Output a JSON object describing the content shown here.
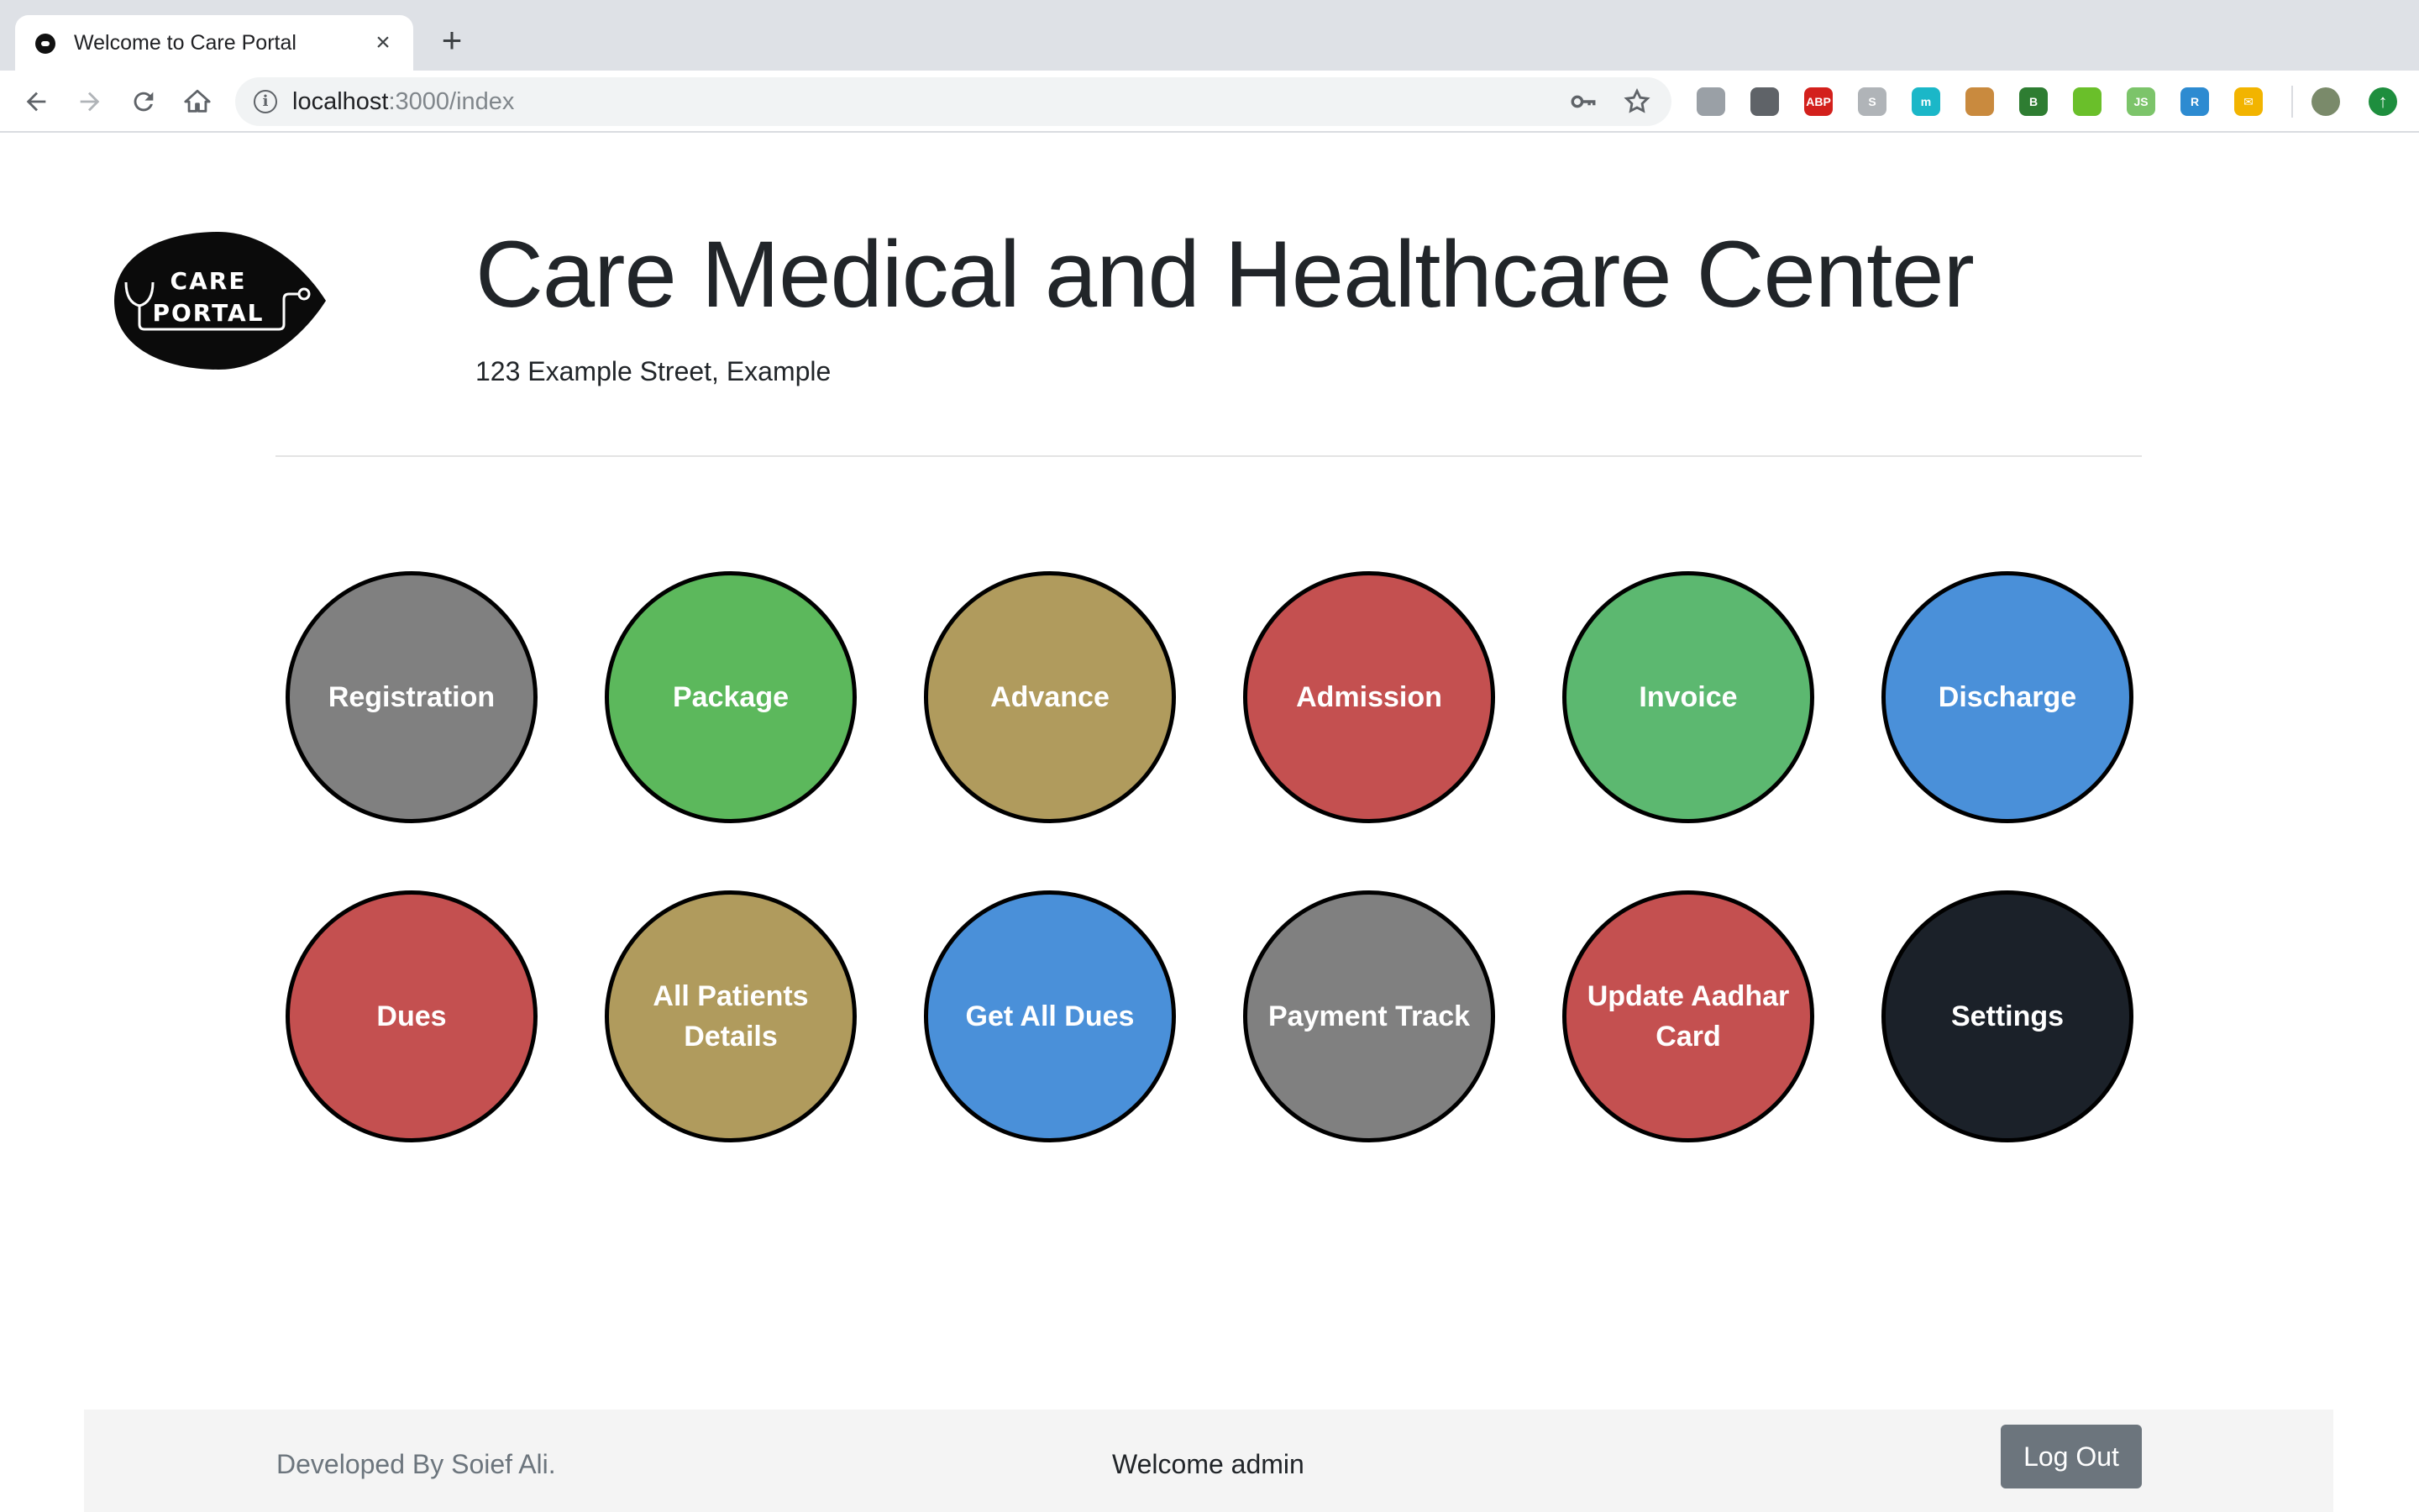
{
  "browser": {
    "tab_title": "Welcome to Care Portal",
    "tab_close": "×",
    "new_tab": "+",
    "url_host": "localhost",
    "url_path": ":3000/index",
    "extensions": [
      {
        "name": "extension-gray-icon",
        "color": "#9aa0a6",
        "label": ""
      },
      {
        "name": "extension-lightbulb-icon",
        "color": "#5f6368",
        "label": ""
      },
      {
        "name": "adblock-plus-icon",
        "color": "#d3201c",
        "label": "ABP"
      },
      {
        "name": "skype-icon",
        "color": "#b0b4b8",
        "label": "S"
      },
      {
        "name": "extension-teal-icon",
        "color": "#1bb7c8",
        "label": "m"
      },
      {
        "name": "cookie-icon",
        "color": "#c98a3e",
        "label": ""
      },
      {
        "name": "extension-b-icon",
        "color": "#2e7d32",
        "label": "B"
      },
      {
        "name": "extension-green-hex-icon",
        "color": "#6abf2a",
        "label": ""
      },
      {
        "name": "extension-js-icon",
        "color": "#7cc46a",
        "label": "JS"
      },
      {
        "name": "extension-r-icon",
        "color": "#2d8bd1",
        "label": "R"
      },
      {
        "name": "mail-icon",
        "color": "#f2b400",
        "label": "✉"
      }
    ]
  },
  "header": {
    "logo_line1": "CARE",
    "logo_line2": "PORTAL",
    "title": "Care Medical and Healthcare Center",
    "address": "123 Example Street, Example"
  },
  "menu": {
    "row1": [
      {
        "name": "registration-button",
        "label": "Registration",
        "color": "#808080"
      },
      {
        "name": "package-button",
        "label": "Package",
        "color": "#5cb85c"
      },
      {
        "name": "advance-button",
        "label": "Advance",
        "color": "#b09b5d"
      },
      {
        "name": "admission-button",
        "label": "Admission",
        "color": "#c45050"
      },
      {
        "name": "invoice-button",
        "label": "Invoice",
        "color": "#5cb870"
      },
      {
        "name": "discharge-button",
        "label": "Discharge",
        "color": "#4a90d9"
      }
    ],
    "row2": [
      {
        "name": "dues-button",
        "label": "Dues",
        "color": "#c45050"
      },
      {
        "name": "all-patients-details-button",
        "label": "All Patients Details",
        "color": "#b09b5d"
      },
      {
        "name": "get-all-dues-button",
        "label": "Get All Dues",
        "color": "#4a90d9"
      },
      {
        "name": "payment-track-button",
        "label": "Payment Track",
        "color": "#808080"
      },
      {
        "name": "update-aadhar-card-button",
        "label": "Update Aadhar Card",
        "color": "#c45050"
      },
      {
        "name": "settings-button",
        "label": "Settings",
        "color": "#1b2129"
      }
    ]
  },
  "footer": {
    "credit": "Developed By Soief Ali.",
    "welcome": "Welcome admin",
    "logout_label": "Log Out"
  }
}
